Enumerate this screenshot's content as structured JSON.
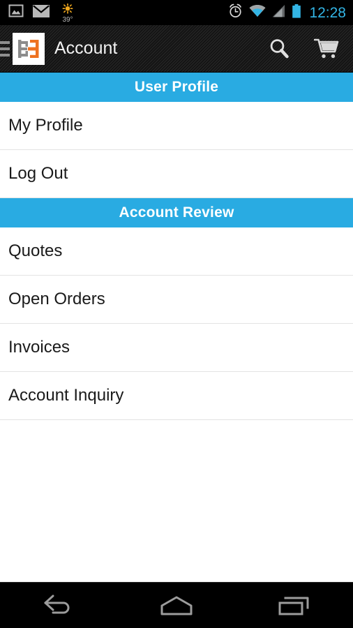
{
  "status_bar": {
    "icons_left": [
      {
        "name": "gallery-image-icon",
        "label": "Image"
      },
      {
        "name": "email-icon",
        "label": "Email"
      },
      {
        "name": "weather-sun-icon",
        "label": "Weather"
      }
    ],
    "weather_temp": "39°",
    "icons_right": [
      {
        "name": "alarm-clock-icon",
        "label": "Alarm"
      },
      {
        "name": "wifi-icon",
        "label": "Wi-Fi"
      },
      {
        "name": "cellular-signal-icon",
        "label": "Signal"
      },
      {
        "name": "battery-icon",
        "label": "Battery"
      }
    ],
    "time": "12:28",
    "time_color": "#33b5e5"
  },
  "action_bar": {
    "drawer_icon": "hamburger-menu-icon",
    "logo_name": "app-logo",
    "title": "Account",
    "actions": [
      {
        "name": "search-icon",
        "label": "Search"
      },
      {
        "name": "shopping-cart-icon",
        "label": "Cart"
      }
    ]
  },
  "theme": {
    "accent_blue": "#29abe2",
    "logo_orange": "#ee7220",
    "logo_gray": "#8c8c8c",
    "action_bar_bg": "#1c1c1c",
    "list_text": "#1a1a1a",
    "divider": "#e3e3e3"
  },
  "sections": [
    {
      "header": "User Profile",
      "items": [
        {
          "label": "My Profile"
        },
        {
          "label": "Log Out"
        }
      ]
    },
    {
      "header": "Account Review",
      "items": [
        {
          "label": "Quotes"
        },
        {
          "label": "Open Orders"
        },
        {
          "label": "Invoices"
        },
        {
          "label": "Account Inquiry"
        }
      ]
    }
  ],
  "nav_bar": {
    "buttons": [
      {
        "name": "nav-back-button",
        "label": "Back"
      },
      {
        "name": "nav-home-button",
        "label": "Home"
      },
      {
        "name": "nav-recents-button",
        "label": "Recent apps"
      }
    ]
  }
}
